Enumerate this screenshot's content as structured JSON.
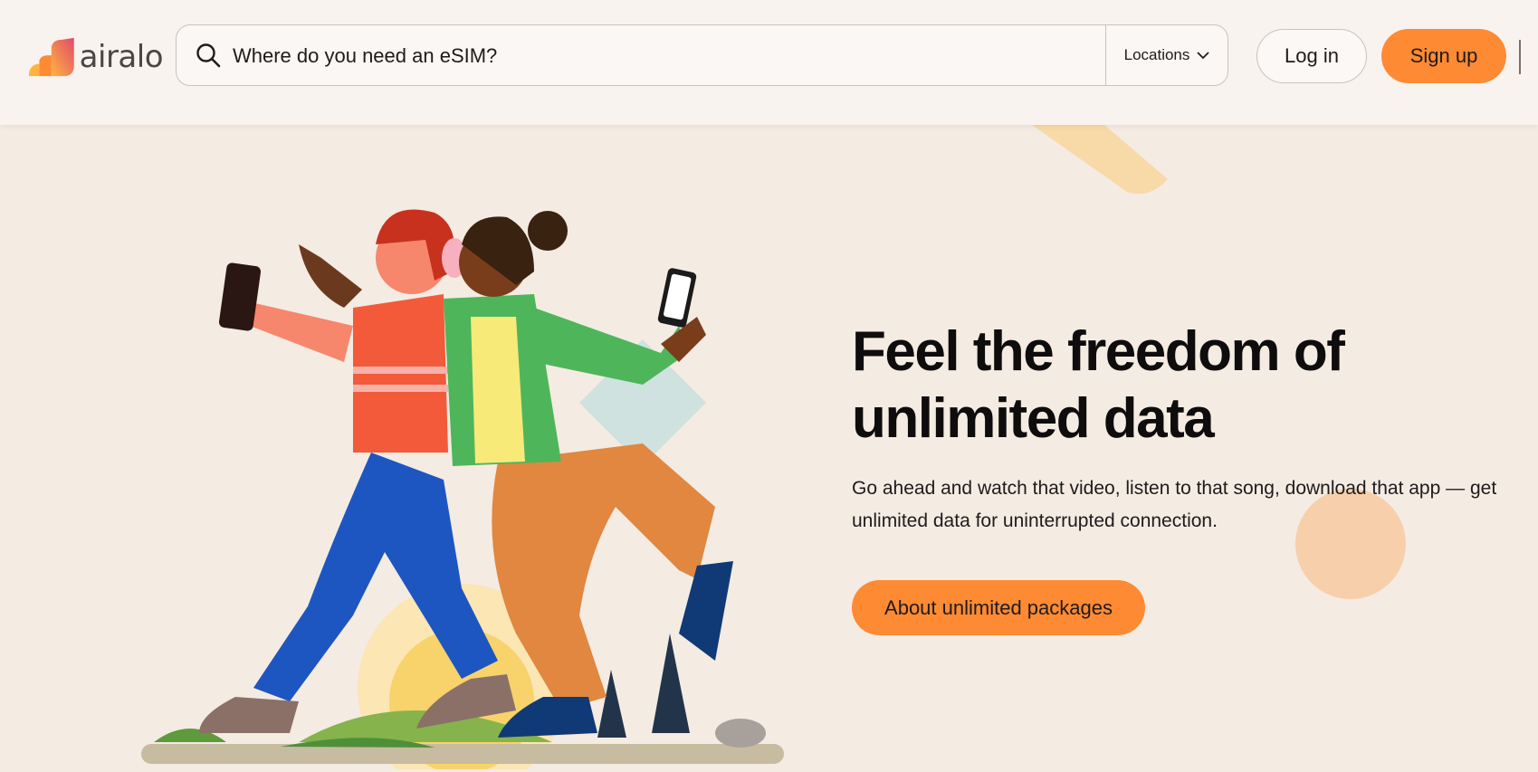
{
  "brand": {
    "name": "airalo",
    "accent": "#ff8a34",
    "logo_icon": "airalo-logo-icon"
  },
  "search": {
    "placeholder": "Where do you need an eSIM?",
    "value": "",
    "icon": "search-icon"
  },
  "locations": {
    "label": "Locations",
    "icon": "chevron-down-icon"
  },
  "auth": {
    "login_label": "Log in",
    "signup_label": "Sign up"
  },
  "hero": {
    "headline": "Feel the freedom of unlimited data",
    "description": "Go ahead and watch that video, listen to that song, download that app — get unlimited data for uninterrupted connection.",
    "cta_label": "About unlimited packages",
    "illustration": "two-people-dancing-with-phones-illustration"
  },
  "colors": {
    "page_bg": "#f4ebe3",
    "header_bg": "#f8f3ef",
    "text": "#0e0c0c"
  }
}
